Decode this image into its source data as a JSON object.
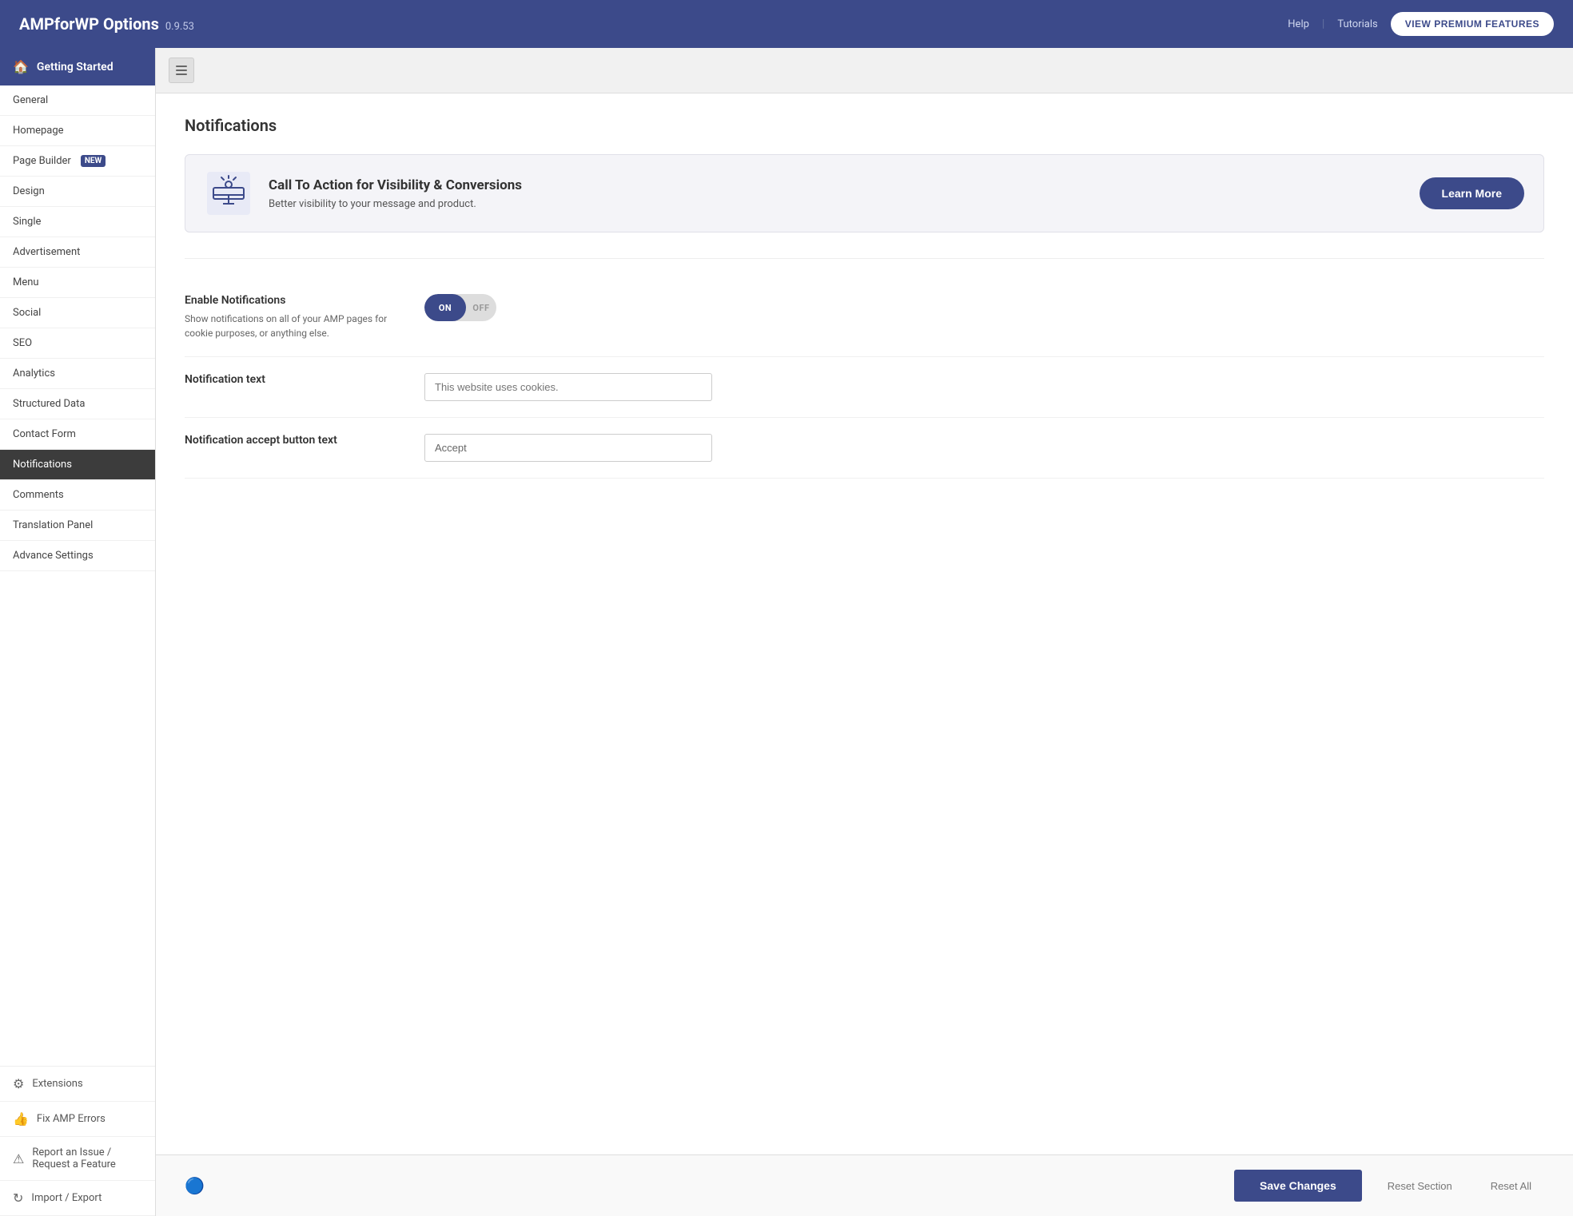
{
  "header": {
    "title": "AMPforWP Options",
    "version": "0.9.53",
    "help_link": "Help",
    "tutorials_link": "Tutorials",
    "premium_btn": "VIEW PREMIUM FEATURES"
  },
  "sidebar": {
    "getting_started": "Getting Started",
    "menu_items": [
      {
        "label": "General",
        "active": false
      },
      {
        "label": "Homepage",
        "active": false
      },
      {
        "label": "Page Builder",
        "active": false,
        "badge": "NEW"
      },
      {
        "label": "Design",
        "active": false
      },
      {
        "label": "Single",
        "active": false
      },
      {
        "label": "Advertisement",
        "active": false
      },
      {
        "label": "Menu",
        "active": false
      },
      {
        "label": "Social",
        "active": false
      },
      {
        "label": "SEO",
        "active": false
      },
      {
        "label": "Analytics",
        "active": false
      },
      {
        "label": "Structured Data",
        "active": false
      },
      {
        "label": "Contact Form",
        "active": false
      },
      {
        "label": "Notifications",
        "active": true
      },
      {
        "label": "Comments",
        "active": false
      },
      {
        "label": "Translation Panel",
        "active": false
      },
      {
        "label": "Advance Settings",
        "active": false
      }
    ],
    "bottom_items": [
      {
        "label": "Extensions",
        "icon": "⚙"
      },
      {
        "label": "Fix AMP Errors",
        "icon": "👍"
      },
      {
        "label": "Report an Issue / Request a Feature",
        "icon": "⚠"
      },
      {
        "label": "Import / Export",
        "icon": "↻"
      }
    ]
  },
  "content": {
    "page_title": "Notifications",
    "promo": {
      "heading": "Call To Action for Visibility & Conversions",
      "subtext": "Better visibility to your message and product.",
      "learn_more_btn": "Learn More"
    },
    "settings": [
      {
        "id": "enable-notifications",
        "label": "Enable Notifications",
        "description": "Show notifications on all of your AMP pages for cookie purposes, or anything else.",
        "control_type": "toggle",
        "toggle_on": "ON",
        "toggle_off": "OFF",
        "value": true
      },
      {
        "id": "notification-text",
        "label": "Notification text",
        "description": "",
        "control_type": "text",
        "placeholder": "This website uses cookies.",
        "value": ""
      },
      {
        "id": "notification-accept-text",
        "label": "Notification accept button text",
        "description": "",
        "control_type": "text",
        "placeholder": "",
        "value": "Accept"
      }
    ]
  },
  "footer": {
    "save_btn": "Save Changes",
    "reset_section_btn": "Reset Section",
    "reset_all_btn": "Reset All"
  }
}
